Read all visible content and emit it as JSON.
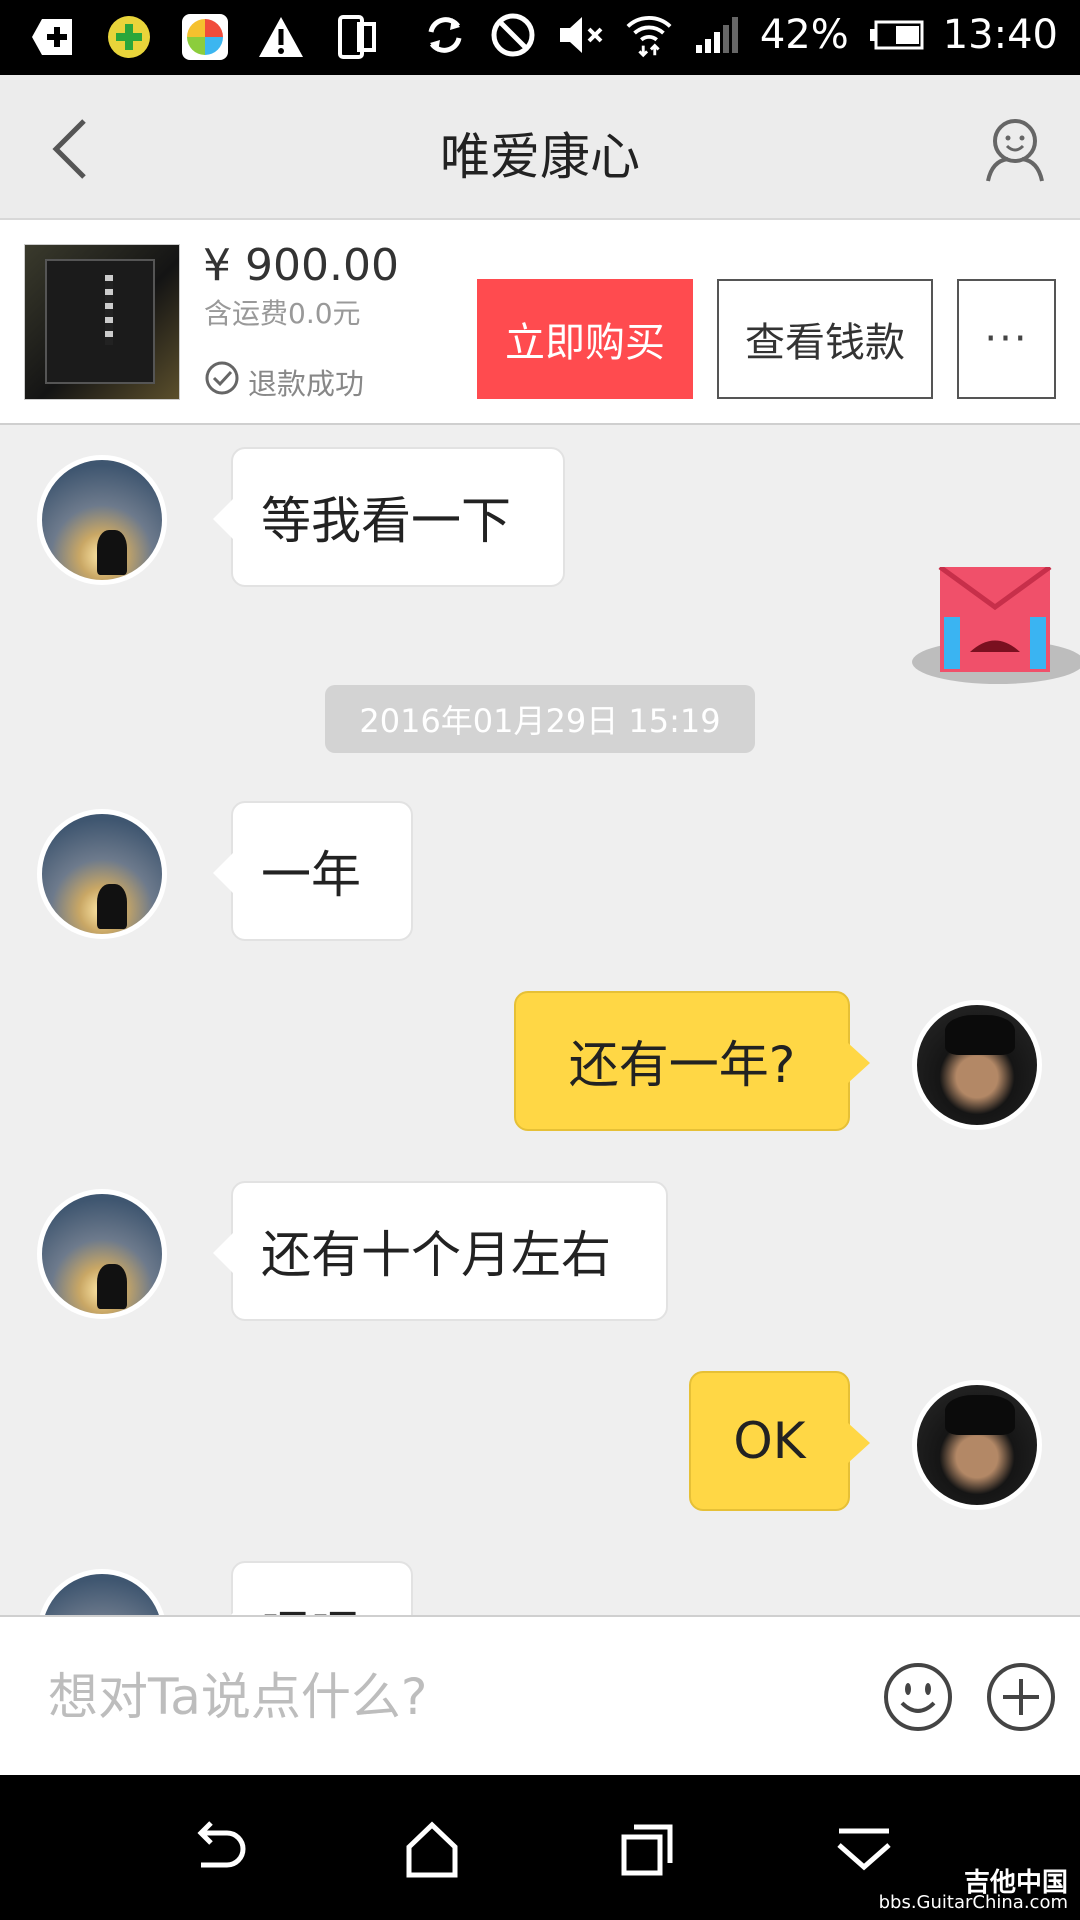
{
  "status_bar": {
    "battery_percent": "42%",
    "time": "13:40",
    "icons": [
      "add-icon",
      "plus-badge-icon",
      "pinwheel-app-icon",
      "warning-icon",
      "phone-mirror-icon",
      "sync-icon",
      "block-icon",
      "mute-icon",
      "wifi-icon",
      "signal-icon",
      "battery-icon"
    ]
  },
  "header": {
    "title": "唯爱康心"
  },
  "product": {
    "price": "¥ 900.00",
    "shipping": "含运费0.0元",
    "status": "退款成功",
    "buy_label": "立即购买",
    "view_label": "查看钱款",
    "more_label": "···"
  },
  "chat": {
    "timestamp": "2016年01月29日 15:19",
    "messages": [
      {
        "side": "left",
        "text": "等我看一下"
      },
      {
        "side": "left",
        "text": "一年"
      },
      {
        "side": "right",
        "text": "还有一年?"
      },
      {
        "side": "left",
        "text": "还有十个月左右"
      },
      {
        "side": "right",
        "text": "OK"
      },
      {
        "side": "left",
        "text": "嗯嗯"
      }
    ]
  },
  "input": {
    "placeholder": "想对Ta说点什么?"
  },
  "watermark": {
    "line1": "吉他中国",
    "line2": "bbs.GuitarChina.com"
  },
  "colors": {
    "buy_button": "#ff4b4f",
    "my_bubble": "#ffd745",
    "nav_background": "#ececec"
  }
}
